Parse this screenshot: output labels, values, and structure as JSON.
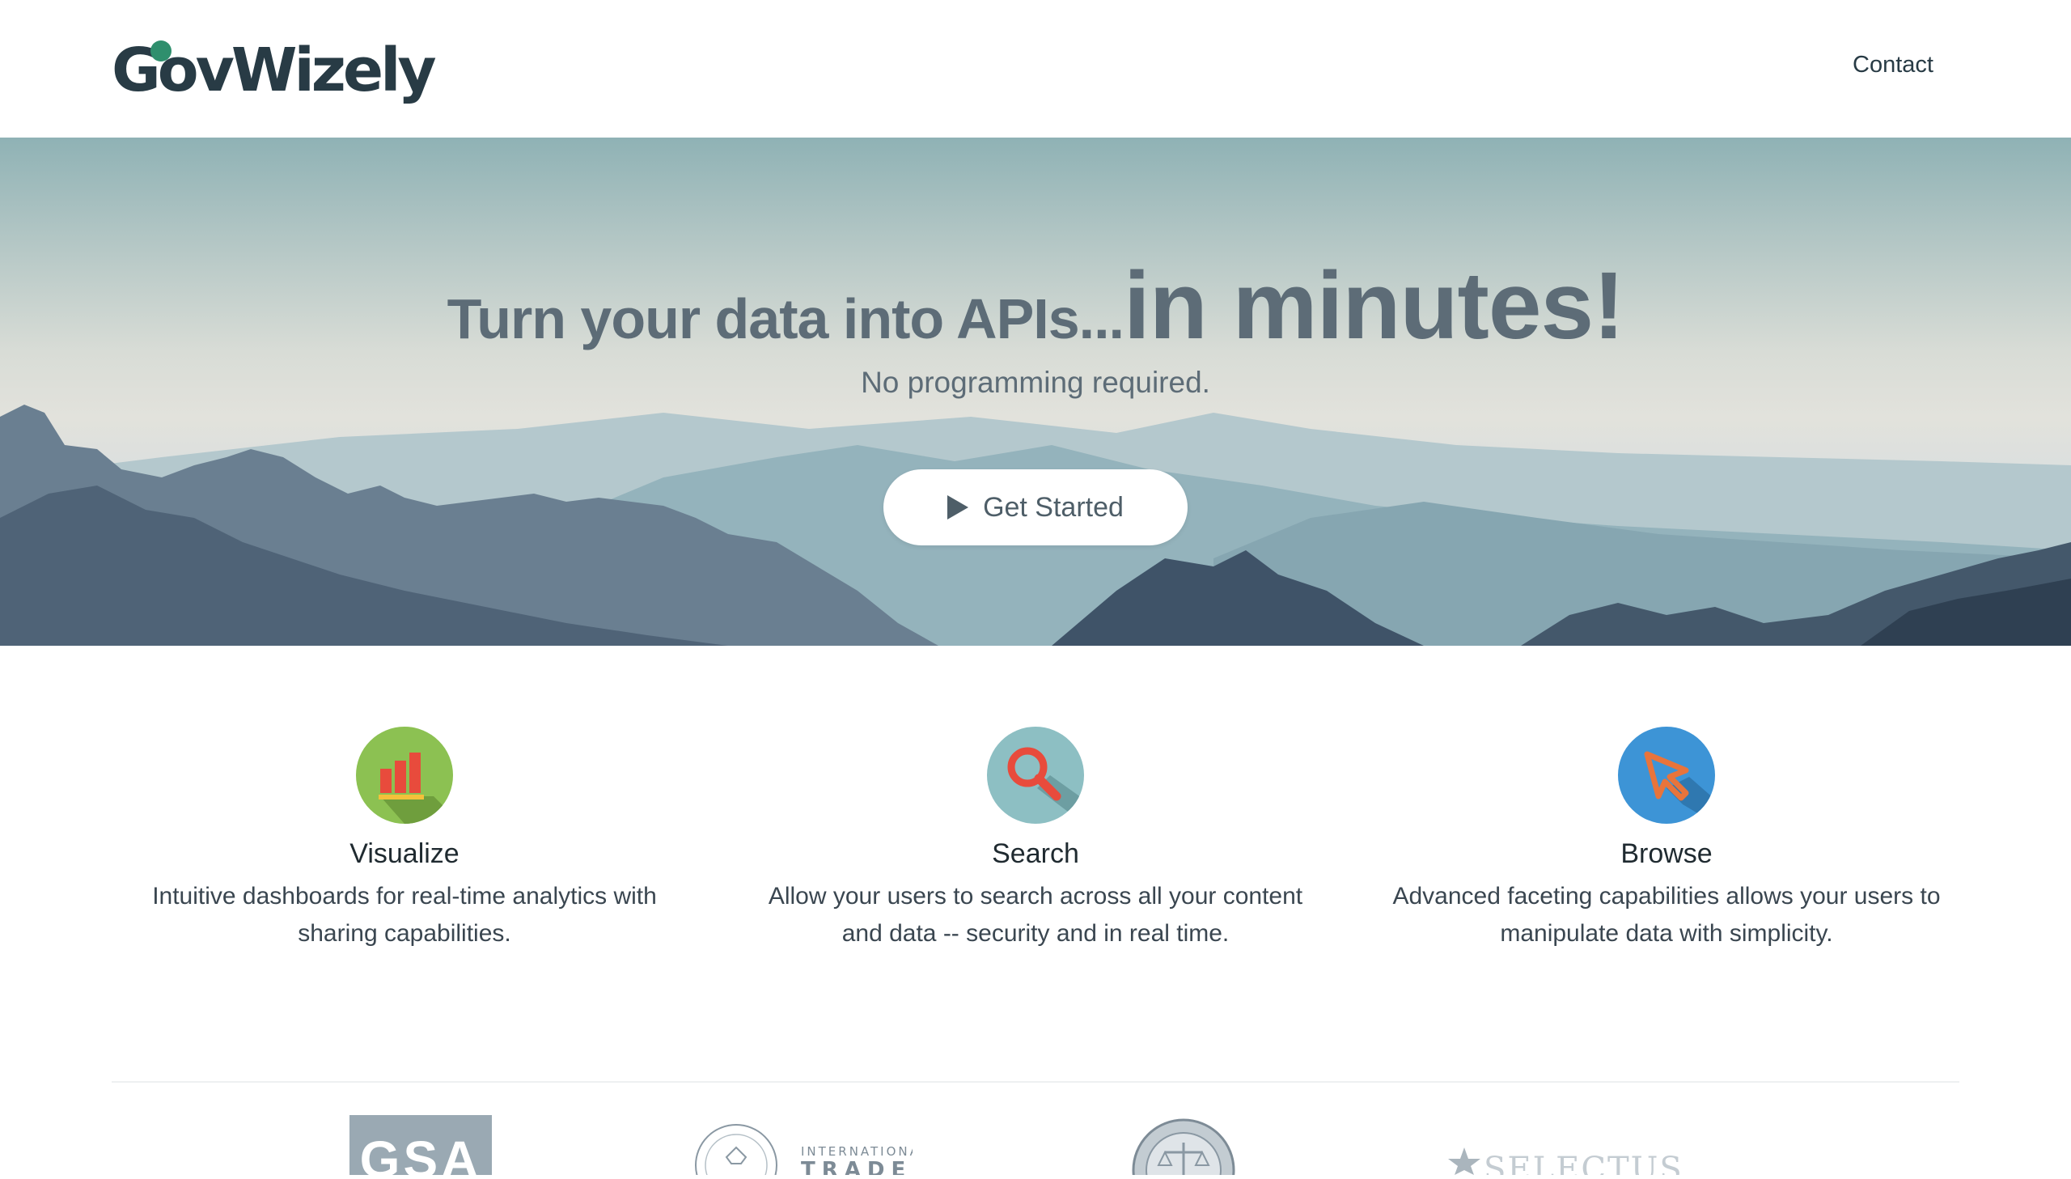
{
  "header": {
    "logo_text": "GovWizely",
    "nav": {
      "contact_label": "Contact"
    }
  },
  "hero": {
    "headline_small": "Turn your data into APIs...",
    "headline_big": "in minutes!",
    "subheadline": "No programming required.",
    "cta_label": "Get Started",
    "cta_icon": "play-icon"
  },
  "features": [
    {
      "icon": "bar-chart-icon",
      "icon_color": "#8cc152",
      "title": "Visualize",
      "description": "Intuitive dashboards for real-time analytics with sharing capabilities."
    },
    {
      "icon": "magnifier-icon",
      "icon_color": "#8dbfc3",
      "title": "Search",
      "description": "Allow your users to search across all your content and data -- security and in real time."
    },
    {
      "icon": "cursor-arrow-icon",
      "icon_color": "#3d94d6",
      "title": "Browse",
      "description": "Advanced faceting capabilities allows your users to manipulate data with simplicity."
    }
  ],
  "partners": {
    "gsa": "GSA",
    "ita_line1": "INTERNATIONAL",
    "ita_line2": "TRADE",
    "selectusa": "SELECTUSA"
  },
  "colors": {
    "brand_dark": "#283b45",
    "hero_text": "#5d6c77",
    "logo_accent": "#2f8f6d"
  }
}
